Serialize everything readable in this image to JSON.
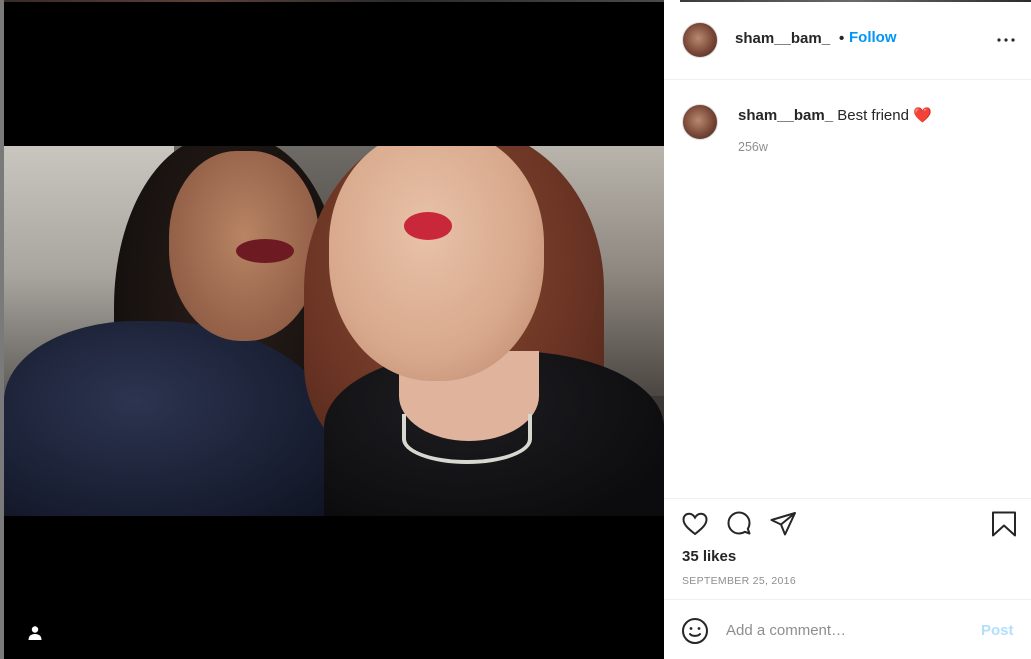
{
  "post": {
    "username": "sham__bam_",
    "separator": "•",
    "follow_label": "Follow",
    "caption_username": "sham__bam_",
    "caption_text": "Best friend",
    "caption_emoji": "❤️",
    "time_ago": "256w",
    "likes": "35 likes",
    "date": "SEPTEMBER 25, 2016"
  },
  "comment": {
    "placeholder": "Add a comment…",
    "post_label": "Post"
  },
  "icons": {
    "more": "more-options-icon",
    "like": "heart-icon",
    "comment": "comment-bubble-icon",
    "share": "paper-plane-icon",
    "save": "bookmark-icon",
    "emoji": "smiley-icon",
    "user_tag": "person-icon"
  },
  "colors": {
    "accent": "#0095f6",
    "post_disabled": "#b2dffc",
    "secondary_text": "#8e8e8e"
  }
}
